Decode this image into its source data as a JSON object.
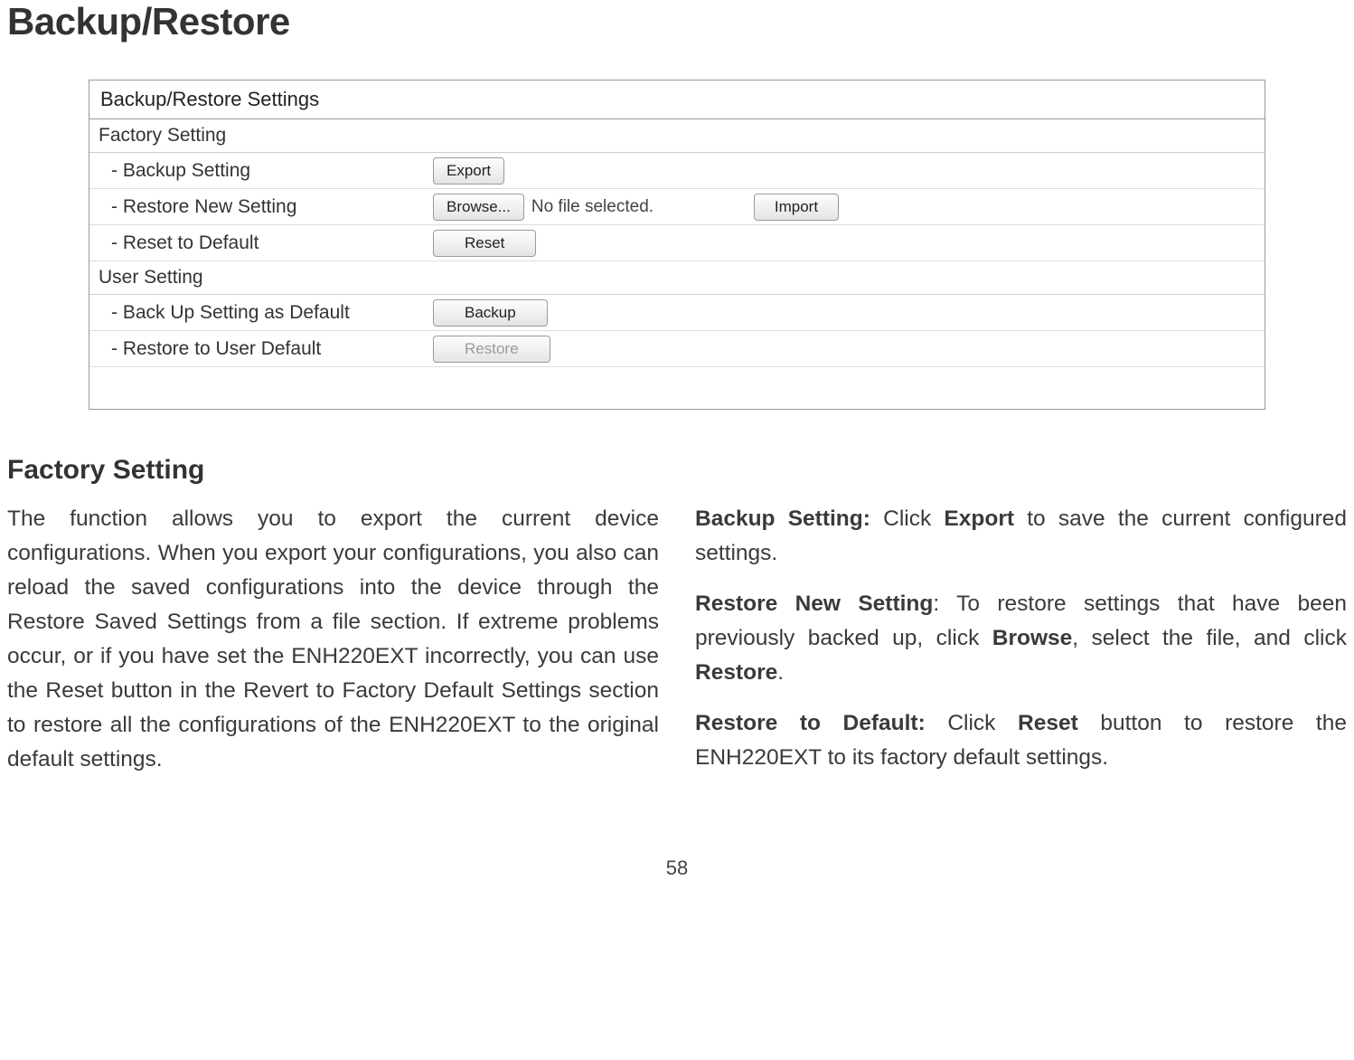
{
  "title": "Backup/Restore",
  "panel": {
    "header": "Backup/Restore Settings",
    "factory": {
      "title": "Factory Setting",
      "backup_label": "- Backup Setting",
      "backup_button": "Export",
      "restore_label": "- Restore New Setting",
      "browse_button": "Browse...",
      "file_text": "No file selected.",
      "import_button": "Import",
      "reset_label": "- Reset to Default",
      "reset_button": "Reset"
    },
    "user": {
      "title": "User Setting",
      "backup_label": "- Back Up Setting as Default",
      "backup_button": "Backup",
      "restore_label": "- Restore to User Default",
      "restore_button": "Restore"
    }
  },
  "subheading": "Factory Setting",
  "left_col": {
    "p1": "The function allows you to export the current device configurations. When you export your configurations, you also can reload the saved configurations into the device through the Restore Saved Settings from a file section. If extreme problems occur, or if you have set the ENH220EXT incorrectly, you can use the Reset button in the Revert to Factory Default Settings section to restore all the configurations of the ENH220EXT to the original default settings."
  },
  "right_col": {
    "backup_b": "Backup Setting:",
    "backup_t1": " Click ",
    "backup_bword": "Export",
    "backup_t2": " to save the current configured settings.",
    "restore_b": "Restore New Setting",
    "restore_t1": ": To restore settings that have been previously backed up, click ",
    "restore_bword": "Browse",
    "restore_t2": ", select the file, and click ",
    "restore_bword2": "Restore",
    "restore_t3": ".",
    "default_b": "Restore to Default:",
    "default_t1": " Click ",
    "default_bword": "Reset",
    "default_t2": " button to restore the ENH220EXT to its factory default settings."
  },
  "pagenum": "58"
}
